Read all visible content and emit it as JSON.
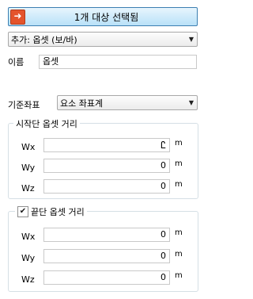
{
  "select_button": {
    "icon": "arrow-into-box-icon",
    "label": "1개 대상 선택됨"
  },
  "add_type": {
    "value": "추가: 옵셋 (보/바)"
  },
  "name": {
    "label": "이름",
    "value": "옵셋"
  },
  "reference": {
    "label": "기준좌표",
    "value": "요소 좌표계"
  },
  "start_offset": {
    "title": "시작단 옵셋 거리",
    "rows": [
      {
        "label": "Wx",
        "value": "",
        "unit": "m"
      },
      {
        "label": "Wy",
        "value": "0",
        "unit": "m"
      },
      {
        "label": "Wz",
        "value": "0",
        "unit": "m"
      }
    ]
  },
  "end_offset": {
    "title": "끝단 옵셋 거리",
    "checked": true,
    "rows": [
      {
        "label": "Wx",
        "value": "0",
        "unit": "m"
      },
      {
        "label": "Wy",
        "value": "0",
        "unit": "m"
      },
      {
        "label": "Wz",
        "value": "0",
        "unit": "m"
      }
    ]
  },
  "colors": {
    "accent_border": "#3c7fb1",
    "icon_bg": "#e4542c"
  }
}
